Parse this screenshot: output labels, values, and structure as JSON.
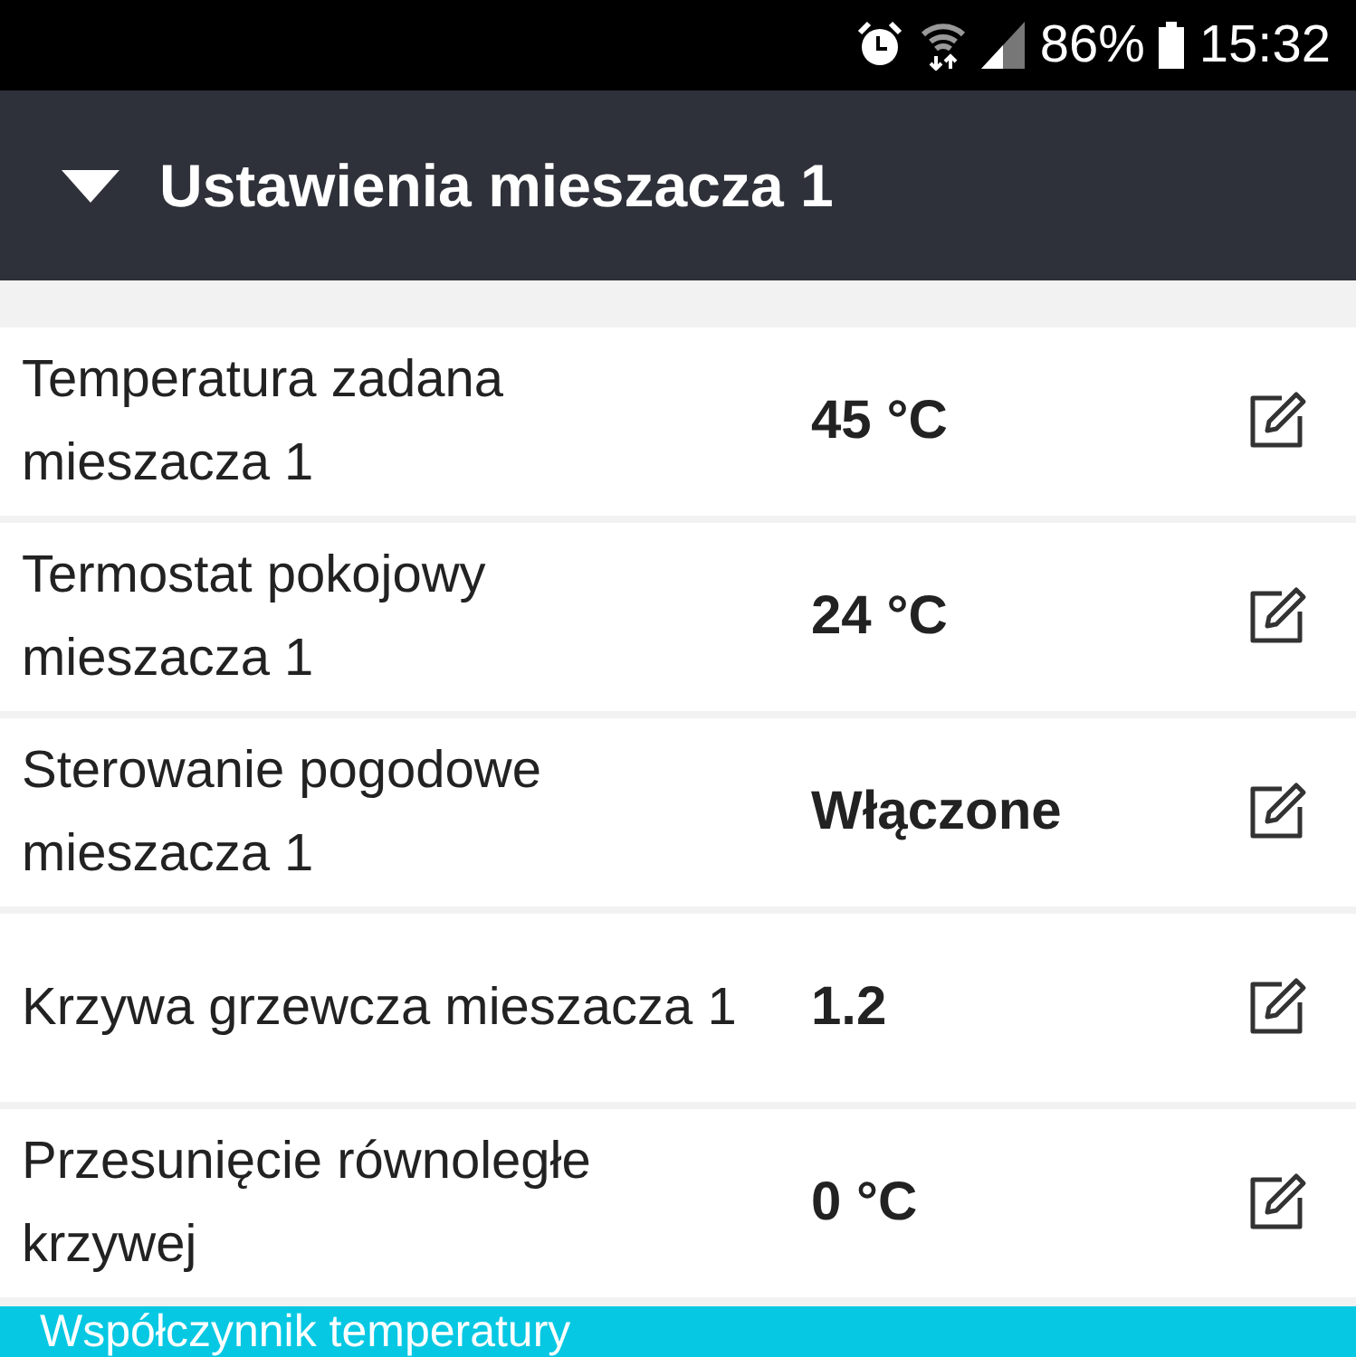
{
  "status_bar": {
    "battery": "86%",
    "time": "15:32"
  },
  "section": {
    "title": "Ustawienia mieszacza 1",
    "expanded": true
  },
  "settings": [
    {
      "label": "Temperatura zadana mieszacza 1",
      "value": "45 °C"
    },
    {
      "label": "Termostat pokojowy mieszacza 1",
      "value": "24 °C"
    },
    {
      "label": "Sterowanie pogodowe mieszacza 1",
      "value": "Włączone"
    },
    {
      "label": "Krzywa grzewcza mieszacza 1",
      "value": "1.2"
    },
    {
      "label": "Przesunięcie równoległe krzywej",
      "value": "0 °C"
    }
  ],
  "next_section": {
    "title": "Współczynnik temperatury"
  }
}
